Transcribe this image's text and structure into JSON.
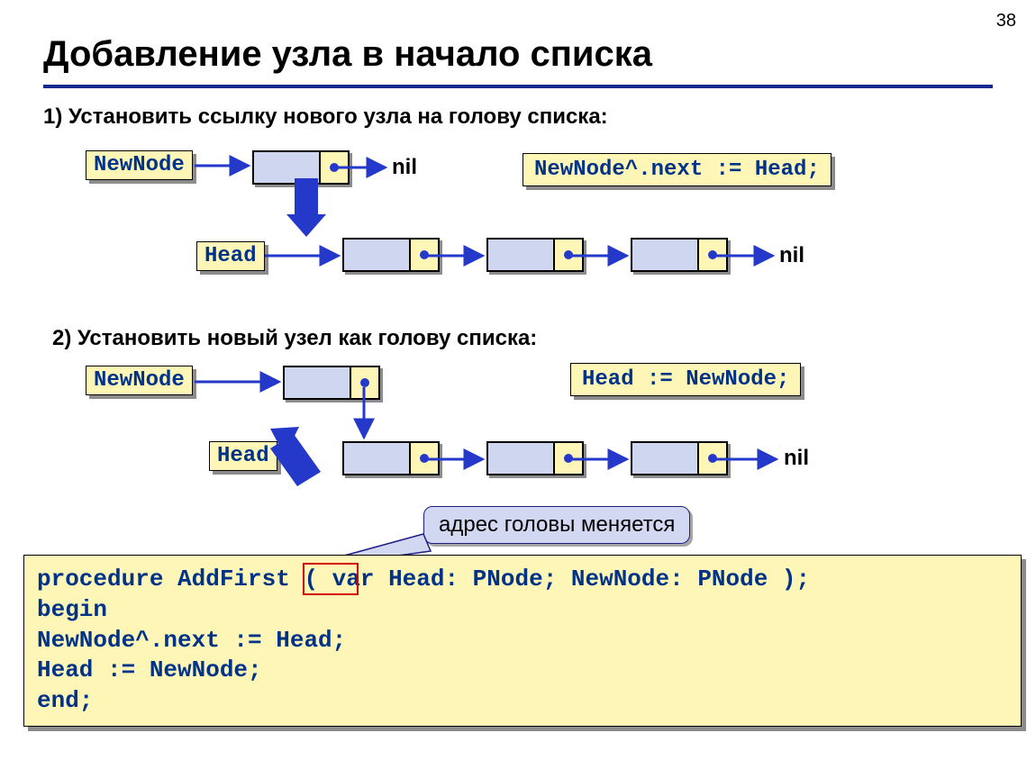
{
  "page_number": "38",
  "title": "Добавление узла в начало списка",
  "step1_text": "1) Установить ссылку нового узла на голову списка:",
  "step2_text": "2) Установить новый узел как голову списка:",
  "labels": {
    "newnode": "NewNode",
    "head": "Head",
    "nil": "nil"
  },
  "code1": "NewNode^.next := Head;",
  "code2": "Head := NewNode;",
  "callout": "адрес головы меняется",
  "proc": {
    "l1": "procedure AddFirst ( var Head: PNode; NewNode: PNode );",
    "l2": "begin",
    "l3": "  NewNode^.next := Head;",
    "l4": "  Head := NewNode;",
    "l5": "end;",
    "highlight": "var"
  }
}
